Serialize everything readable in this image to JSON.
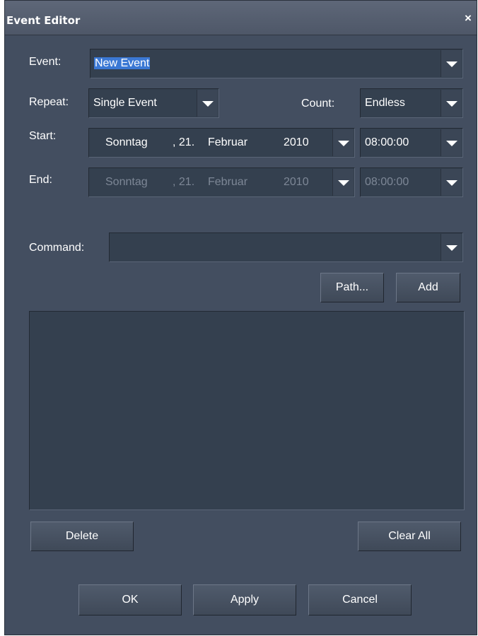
{
  "window": {
    "title": "Event Editor",
    "close_glyph": "×"
  },
  "event": {
    "label": "Event:",
    "value": "New Event"
  },
  "repeat": {
    "label": "Repeat:",
    "value": "Single Event"
  },
  "count": {
    "label": "Count:",
    "value": "Endless"
  },
  "start": {
    "label": "Start:",
    "weekday": "Sonntag",
    "day": ", 21.",
    "month": "Februar",
    "year": "2010",
    "time": "08:00:00"
  },
  "end": {
    "label": "End:",
    "weekday": "Sonntag",
    "day": ", 21.",
    "month": "Februar",
    "year": "2010",
    "time": "08:00:00"
  },
  "command": {
    "label": "Command:",
    "value": ""
  },
  "buttons": {
    "path": "Path...",
    "add": "Add",
    "delete": "Delete",
    "clear_all": "Clear All",
    "ok": "OK",
    "apply": "Apply",
    "cancel": "Cancel"
  },
  "icons": {
    "dropdown": "chevron-down-icon",
    "close": "close-icon"
  },
  "colors": {
    "window_bg": "#434e60",
    "field_bg": "#34404f",
    "selection": "#3b78d4",
    "disabled_text": "#7d8796"
  }
}
